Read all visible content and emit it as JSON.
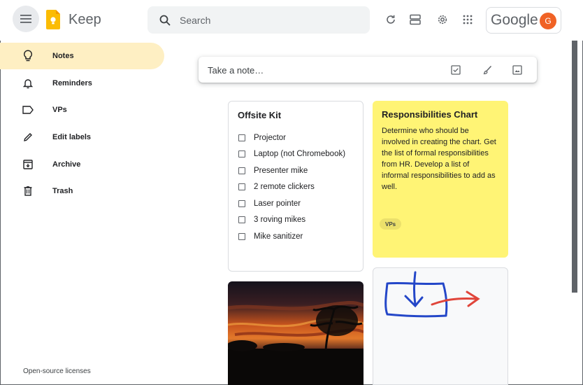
{
  "header": {
    "app_title": "Keep",
    "search_placeholder": "Search",
    "account_brand": "Google",
    "avatar_letter": "G"
  },
  "sidebar": {
    "items": [
      {
        "label": "Notes",
        "icon": "lightbulb-icon",
        "active": true
      },
      {
        "label": "Reminders",
        "icon": "bell-icon",
        "active": false
      },
      {
        "label": "VPs",
        "icon": "label-icon",
        "active": false
      },
      {
        "label": "Edit labels",
        "icon": "pencil-icon",
        "active": false
      },
      {
        "label": "Archive",
        "icon": "archive-icon",
        "active": false
      },
      {
        "label": "Trash",
        "icon": "trash-icon",
        "active": false
      }
    ],
    "footer": "Open-source licenses"
  },
  "take_note": {
    "placeholder": "Take a note…"
  },
  "notes": {
    "offsite": {
      "title": "Offsite Kit",
      "items": [
        "Projector",
        "Laptop (not Chromebook)",
        "Presenter mike",
        "2 remote clickers",
        "Laser pointer",
        "3 roving mikes",
        "Mike sanitizer"
      ]
    },
    "responsibilities": {
      "title": "Responsibilities Chart",
      "body": "Determine who should be involved in creating the chart. Get the list of formal responsibilities from HR. Develop a list of informal responsibilities to add as well.",
      "label": "VPs",
      "color": "#fff475"
    }
  },
  "colors": {
    "accent_active": "#feefc3",
    "keep_yellow": "#fbbc04",
    "avatar": "#f06225"
  }
}
